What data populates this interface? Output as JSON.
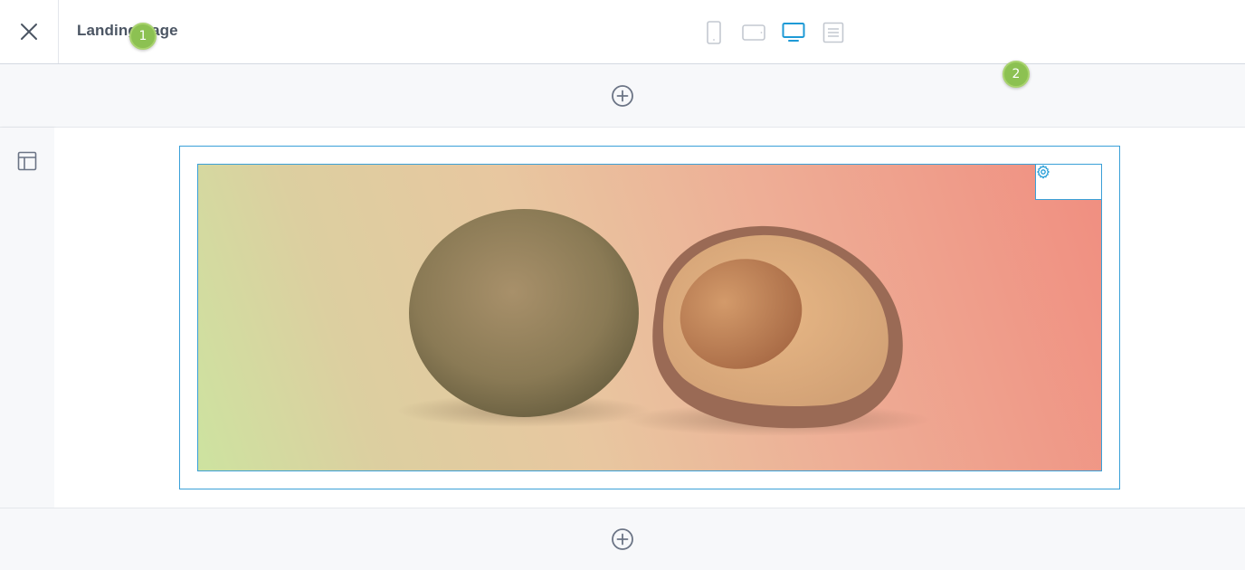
{
  "header": {
    "title": "Landing page",
    "close_icon": "close-icon",
    "devices": [
      {
        "name": "mobile",
        "icon": "phone-icon",
        "active": false
      },
      {
        "name": "tablet",
        "icon": "tablet-icon",
        "active": false
      },
      {
        "name": "desktop",
        "icon": "desktop-icon",
        "active": true
      },
      {
        "name": "text",
        "icon": "document-icon",
        "active": false
      }
    ]
  },
  "colors": {
    "accent": "#1e9ad6",
    "badge": "#8cc152",
    "icon_muted": "#c3c8d0",
    "frame": "#3aa0d8"
  },
  "editor": {
    "add_section_icon": "plus-circle-icon",
    "side_rail_icon": "layout-icon",
    "banner": {
      "settings_icon": "gear-icon"
    },
    "badges": [
      "1",
      "2"
    ]
  }
}
